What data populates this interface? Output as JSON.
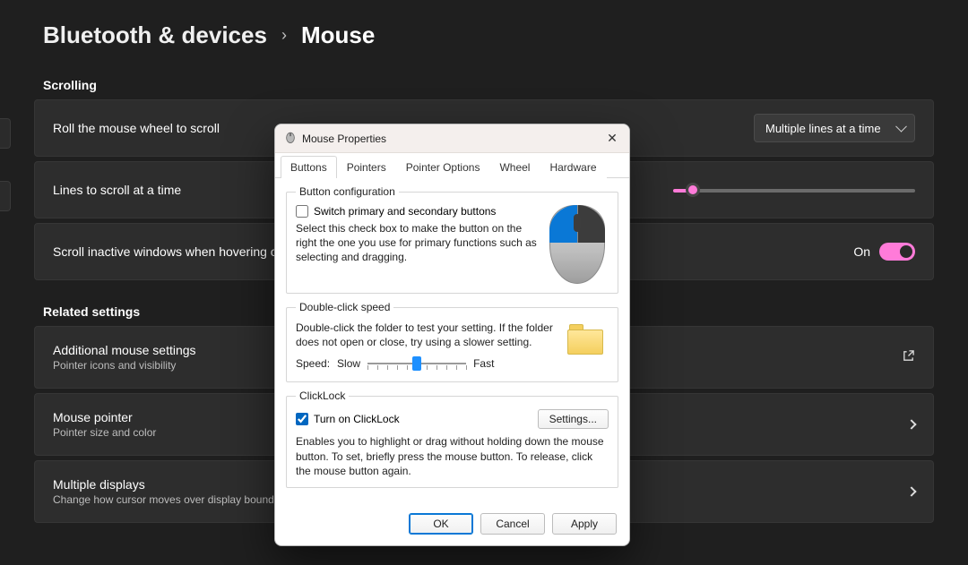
{
  "breadcrumb": {
    "parent": "Bluetooth & devices",
    "current": "Mouse"
  },
  "sections": {
    "scrolling_title": "Scrolling",
    "related_title": "Related settings"
  },
  "rows": {
    "roll_label": "Roll the mouse wheel to scroll",
    "roll_value": "Multiple lines at a time",
    "lines_label": "Lines to scroll at a time",
    "inactive_label": "Scroll inactive windows when hovering over them",
    "inactive_state": "On",
    "additional_label": "Additional mouse settings",
    "additional_sub": "Pointer icons and visibility",
    "pointer_label": "Mouse pointer",
    "pointer_sub": "Pointer size and color",
    "displays_label": "Multiple displays",
    "displays_sub": "Change how cursor moves over display boundaries"
  },
  "dialog": {
    "title": "Mouse Properties",
    "tabs": [
      "Buttons",
      "Pointers",
      "Pointer Options",
      "Wheel",
      "Hardware"
    ],
    "group1": {
      "legend": "Button configuration",
      "checkbox": "Switch primary and secondary buttons",
      "desc": "Select this check box to make the button on the right the one you use for primary functions such as selecting and dragging."
    },
    "group2": {
      "legend": "Double-click speed",
      "desc": "Double-click the folder to test your setting. If the folder does not open or close, try using a slower setting.",
      "speed_label": "Speed:",
      "slow": "Slow",
      "fast": "Fast"
    },
    "group3": {
      "legend": "ClickLock",
      "checkbox": "Turn on ClickLock",
      "settings_btn": "Settings...",
      "desc": "Enables you to highlight or drag without holding down the mouse button. To set, briefly press the mouse button. To release, click the mouse button again."
    },
    "buttons": {
      "ok": "OK",
      "cancel": "Cancel",
      "apply": "Apply"
    }
  }
}
